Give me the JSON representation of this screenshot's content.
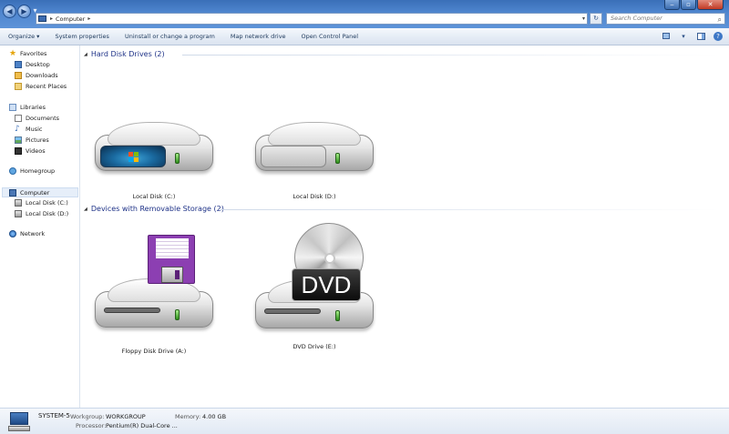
{
  "window": {
    "minimize": "‒",
    "maximize": "▫",
    "close": "✕"
  },
  "nav": {
    "back": "◀",
    "forward": "▶",
    "recent": "▾"
  },
  "address": {
    "crumbs": [
      "Computer"
    ],
    "separator": "▸",
    "refresh": "↻"
  },
  "search": {
    "placeholder": "Search Computer"
  },
  "commands": [
    "Organize ▾",
    "System properties",
    "Uninstall or change a program",
    "Map network drive",
    "Open Control Panel"
  ],
  "nav_pane": {
    "favorites": "Favorites",
    "desktop": "Desktop",
    "downloads": "Downloads",
    "recent_places": "Recent Places",
    "libraries": "Libraries",
    "documents": "Documents",
    "music": "Music",
    "pictures": "Pictures",
    "videos": "Videos",
    "homegroup": "Homegroup",
    "computer": "Computer",
    "local_c": "Local Disk (C:)",
    "local_d": "Local Disk (D:)",
    "network": "Network"
  },
  "groups": {
    "hard_disks": "Hard Disk Drives (2)",
    "removable": "Devices with Removable Storage (2)"
  },
  "drives": {
    "c": "Local Disk (C:)",
    "d": "Local Disk (D:)",
    "floppy": "Floppy Disk Drive (A:)",
    "dvd": "DVD Drive (E:)",
    "dvd_badge": "DVD"
  },
  "details": {
    "name": "SYSTEM-5",
    "workgroup_label": "Workgroup:",
    "workgroup": "WORKGROUP",
    "memory_label": "Memory:",
    "memory": "4.00 GB",
    "processor_label": "Processor:",
    "processor": "Pentium(R) Dual-Core ..."
  },
  "colors": {
    "titlebar": "#4f86cf",
    "group_header": "#1e3287",
    "command_text": "#1e395b"
  }
}
